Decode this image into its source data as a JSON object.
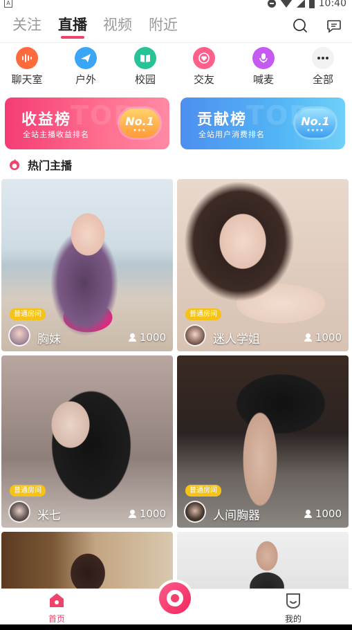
{
  "status_bar": {
    "left_indicator": "A",
    "time": "10:40"
  },
  "top_tabs": [
    {
      "label": "关注",
      "active": false
    },
    {
      "label": "直播",
      "active": true
    },
    {
      "label": "视频",
      "active": false
    },
    {
      "label": "附近",
      "active": false
    }
  ],
  "header_icons": [
    "search-icon",
    "message-icon"
  ],
  "categories": [
    {
      "label": "聊天室",
      "icon": "audio-wave-icon",
      "color": "#ff6a3d"
    },
    {
      "label": "户外",
      "icon": "plane-icon",
      "color": "#3aa6f5"
    },
    {
      "label": "校园",
      "icon": "book-icon",
      "color": "#27c296"
    },
    {
      "label": "交友",
      "icon": "heart-icon",
      "color": "#ff5f8a"
    },
    {
      "label": "喊麦",
      "icon": "microphone-icon",
      "color": "#c45af0"
    },
    {
      "label": "全部",
      "icon": "more-icon",
      "color": "#f2f2f2"
    }
  ],
  "banners": [
    {
      "title": "收益榜",
      "subtitle": "全站主播收益排名",
      "medal": "No.1",
      "watermark": "TOP"
    },
    {
      "title": "贡献榜",
      "subtitle": "全站用户消费排名",
      "medal": "No.1",
      "watermark": "TOP"
    }
  ],
  "section": {
    "title": "热门主播"
  },
  "cards": [
    {
      "tag": "普通房间",
      "name": "胸妹",
      "viewers": "1000"
    },
    {
      "tag": "普通房间",
      "name": "迷人学姐",
      "viewers": "1000"
    },
    {
      "tag": "普通房间",
      "name": "米七",
      "viewers": "1000"
    },
    {
      "tag": "普通房间",
      "name": "人间胸器",
      "viewers": "1000"
    },
    {
      "tag": "",
      "name": "",
      "viewers": ""
    },
    {
      "tag": "",
      "name": "",
      "viewers": ""
    }
  ],
  "bottom_nav": {
    "home_label": "首页",
    "mine_label": "我的"
  },
  "colors": {
    "accent": "#f0436c",
    "tag": "#f5c218"
  }
}
